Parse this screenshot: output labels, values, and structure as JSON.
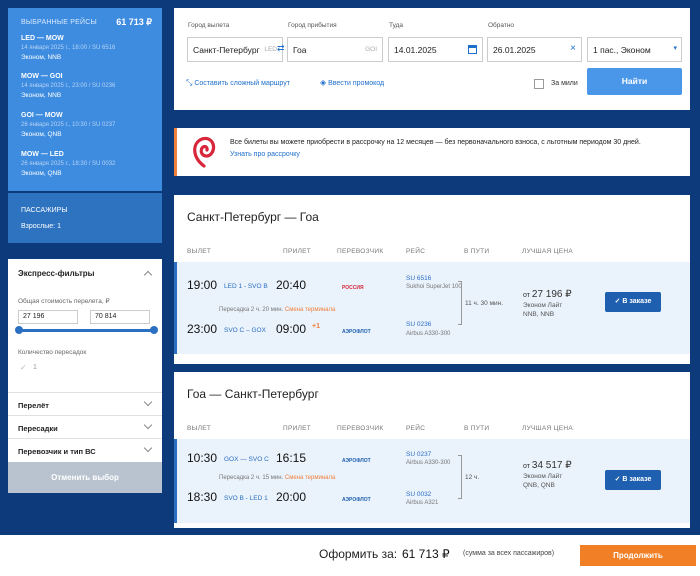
{
  "sidebar": {
    "header": "ВЫБРАННЫЕ РЕЙСЫ",
    "total": "61 713 ₽",
    "legs": [
      {
        "route": "LED — MOW",
        "details": "14 января 2025 г., 18:00 / SU 6516",
        "class": "Эконом, NNB"
      },
      {
        "route": "MOW — GOI",
        "details": "14 января 2025 г., 23:00 / SU 0236",
        "class": "Эконом, NNB"
      },
      {
        "route": "GOI — MOW",
        "details": "26 января 2025 г., 10:30 / SU 0237",
        "class": "Эконом, QNB"
      },
      {
        "route": "MOW — LED",
        "details": "26 января 2025 г., 18:30 / SU 0032",
        "class": "Эконом, QNB"
      }
    ],
    "passengers_header": "ПАССАЖИРЫ",
    "passengers": "Взрослые: 1"
  },
  "filters": {
    "title": "Экспресс-фильтры",
    "price_label": "Общая стоимость перелета, ₽",
    "price_min": "27 196",
    "price_max": "70 814",
    "transfers_label": "Количество пересадок",
    "transfers_value": "1",
    "sections": [
      "Перелёт",
      "Пересадки",
      "Перевозчик и тип ВС"
    ],
    "reset": "Отменить выбор"
  },
  "search": {
    "from_label": "Город вылета",
    "from_value": "Санкт-Петербург",
    "from_code": "LED",
    "to_label": "Город прибытия",
    "to_value": "Гоа",
    "to_code": "GOI",
    "depart_label": "Туда",
    "depart_value": "14.01.2025",
    "return_label": "Обратно",
    "return_value": "26.01.2025",
    "pax_value": "1 пас., Эконом",
    "complex_route": "Составить сложный маршрут",
    "promo_code": "Ввести промокод",
    "miles": "За мили",
    "find": "Найти"
  },
  "promo": {
    "text": "Все билеты вы можете приобрести в рассрочку на 12 месяцев — без первоначального взноса, с льготным периодом 30 дней.",
    "link": "Узнать про рассрочку"
  },
  "columns": {
    "depart": "ВЫЛЕТ",
    "arrive": "ПРИЛЕТ",
    "carrier": "ПЕРЕВОЗЧИК",
    "flight": "РЕЙС",
    "duration": "В ПУТИ",
    "price": "ЛУЧШАЯ ЦЕНА"
  },
  "outbound": {
    "title": "Санкт-Петербург — Гоа",
    "seg1": {
      "dep": "19:00",
      "route": "LED 1 - SVO B",
      "arr": "20:40",
      "flight": "SU 6516",
      "aircraft": "Sukhoi SuperJet 100",
      "carrier": "РОССИЯ"
    },
    "transfer": "Пересадка 2 ч. 20 мин.",
    "transfer_warn": "Смена терминала",
    "seg2": {
      "dep": "23:00",
      "route": "SVO C – GOX",
      "arr": "09:00",
      "plus": "+1",
      "flight": "SU 0236",
      "aircraft": "Airbus A330-300",
      "carrier": "АЭРОФЛОТ"
    },
    "duration": "11 ч. 30 мин.",
    "price_prefix": "от",
    "price": "27 196 ₽",
    "fare": "Эконом Лайт",
    "fare_codes": "NNB, NNB",
    "button": "В заказе"
  },
  "inbound": {
    "title": "Гоа — Санкт-Петербург",
    "seg1": {
      "dep": "10:30",
      "route": "GOX — SVO C",
      "arr": "16:15",
      "flight": "SU 0237",
      "aircraft": "Airbus A330-300",
      "carrier": "АЭРОФЛОТ"
    },
    "transfer": "Пересадка 2 ч. 15 мин.",
    "transfer_warn": "Смена терминала",
    "seg2": {
      "dep": "18:30",
      "route": "SVO B - LED 1",
      "arr": "20:00",
      "flight": "SU 0032",
      "aircraft": "Airbus A321",
      "carrier": "АЭРОФЛОТ"
    },
    "duration": "12 ч.",
    "price_prefix": "от",
    "price": "34 517 ₽",
    "fare": "Эконом Лайт",
    "fare_codes": "QNB, QNB",
    "button": "В заказе"
  },
  "footer": {
    "label": "Оформить за:",
    "total": "61 713 ₽",
    "note": "(сумма за всех пассажиров)",
    "continue": "Продолжить"
  }
}
